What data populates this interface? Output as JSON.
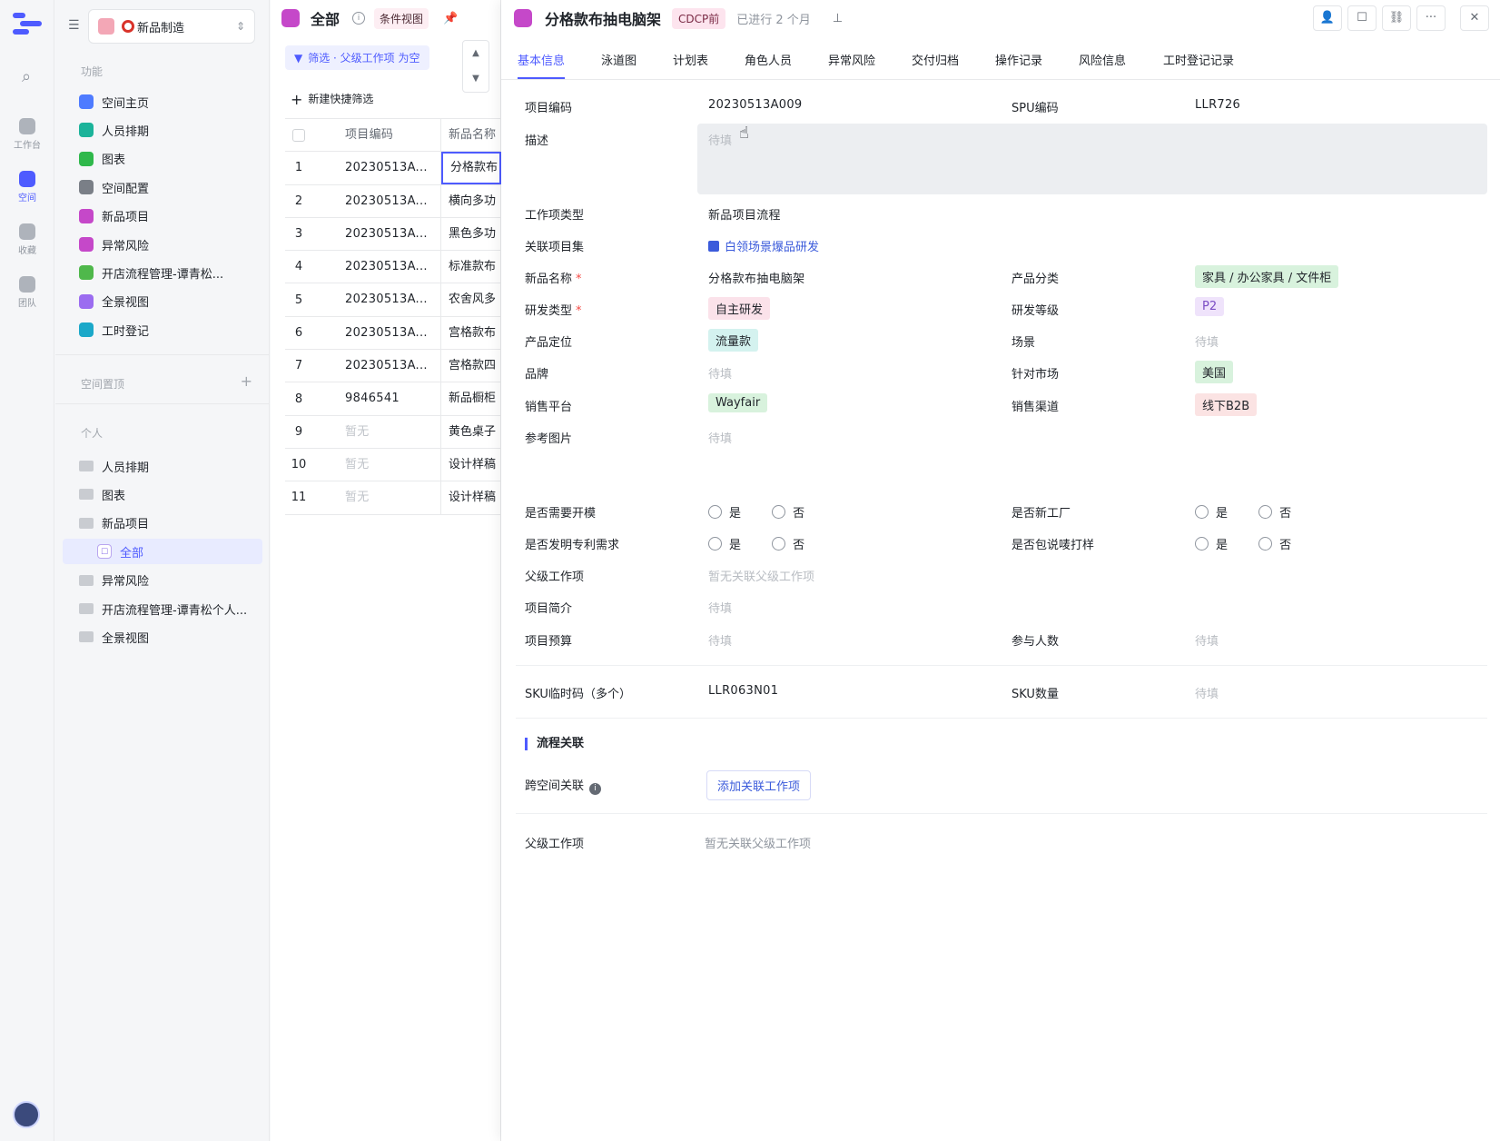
{
  "rail": {
    "items": [
      {
        "label": "工作台"
      },
      {
        "label": "空间"
      },
      {
        "label": "收藏"
      },
      {
        "label": "团队"
      }
    ]
  },
  "sidebar": {
    "space_name": "新品制造",
    "section_features": "功能",
    "features": [
      {
        "label": "空间主页",
        "color": "#4e7bff"
      },
      {
        "label": "人员排期",
        "color": "#1bb39a"
      },
      {
        "label": "图表",
        "color": "#2fb84b"
      },
      {
        "label": "空间配置",
        "color": "#7a7f87"
      },
      {
        "label": "新品项目",
        "color": "#c548c9"
      },
      {
        "label": "异常风险",
        "color": "#c548c9"
      },
      {
        "label": "开店流程管理-谭青松...",
        "color": "#4fb84b"
      },
      {
        "label": "全景视图",
        "color": "#9b6cf0"
      },
      {
        "label": "工时登记",
        "color": "#1ba8c9"
      }
    ],
    "section_pinned": "空间置顶",
    "section_personal": "个人",
    "personal": [
      {
        "label": "人员排期"
      },
      {
        "label": "图表"
      },
      {
        "label": "新品项目"
      },
      {
        "label": "全部",
        "selected": true
      },
      {
        "label": "异常风险"
      },
      {
        "label": "开店流程管理-谭青松个人..."
      },
      {
        "label": "全景视图"
      }
    ]
  },
  "list": {
    "title": "全部",
    "view_badge": "条件视图",
    "filter": "筛选 · 父级工作项 为空",
    "quick_filter": "新建快捷筛选",
    "columns": [
      "项目编码",
      "新品名称"
    ],
    "rows": [
      {
        "idx": "1",
        "code": "20230513A...",
        "name": "分格款布",
        "selected": true
      },
      {
        "idx": "2",
        "code": "20230513A...",
        "name": "横向多功"
      },
      {
        "idx": "3",
        "code": "20230513A...",
        "name": "黑色多功"
      },
      {
        "idx": "4",
        "code": "20230513A...",
        "name": "标准款布"
      },
      {
        "idx": "5",
        "code": "20230513A...",
        "name": "农舍风多"
      },
      {
        "idx": "6",
        "code": "20230513A...",
        "name": "宫格款布"
      },
      {
        "idx": "7",
        "code": "20230513A...",
        "name": "宫格款四"
      },
      {
        "idx": "8",
        "code": "9846541",
        "name": "新品橱柜"
      },
      {
        "idx": "9",
        "code": "暂无",
        "name": "黄色桌子",
        "muted": true
      },
      {
        "idx": "10",
        "code": "暂无",
        "name": "设计样稿",
        "muted": true
      },
      {
        "idx": "11",
        "code": "暂无",
        "name": "设计样稿",
        "muted": true
      }
    ]
  },
  "detail": {
    "title": "分格款布抽电脑架",
    "stage": "CDCP前",
    "progress": "已进行 2 个月",
    "tabs": [
      "基本信息",
      "泳道图",
      "计划表",
      "角色人员",
      "异常风险",
      "交付归档",
      "操作记录",
      "风险信息",
      "工时登记记录"
    ],
    "placeholder": "待填",
    "fields": {
      "project_code_label": "项目编码",
      "project_code": "20230513A009",
      "spu_label": "SPU编码",
      "spu": "LLR726",
      "desc_label": "描述",
      "work_type_label": "工作项类型",
      "work_type": "新品项目流程",
      "linked_set_label": "关联项目集",
      "linked_set": "白领场景爆品研发",
      "name_label": "新品名称",
      "name": "分格款布抽电脑架",
      "category_label": "产品分类",
      "category": "家具 / 办公家具 / 文件柜",
      "rd_type_label": "研发类型",
      "rd_type": "自主研发",
      "rd_level_label": "研发等级",
      "rd_level": "P2",
      "positioning_label": "产品定位",
      "positioning": "流量款",
      "scene_label": "场景",
      "brand_label": "品牌",
      "market_label": "针对市场",
      "market": "美国",
      "platform_label": "销售平台",
      "platform": "Wayfair",
      "channel_label": "销售渠道",
      "channel": "线下B2B",
      "ref_img_label": "参考图片",
      "need_mold_label": "是否需要开模",
      "new_factory_label": "是否新工厂",
      "patent_label": "是否发明专利需求",
      "sample_label": "是否包说唛打样",
      "yes": "是",
      "no": "否",
      "parent_label": "父级工作项",
      "parent": "暂无关联父级工作项",
      "intro_label": "项目简介",
      "budget_label": "项目预算",
      "people_label": "参与人数",
      "sku_tmp_label": "SKU临时码（多个）",
      "sku_tmp": "LLR063N01",
      "sku_count_label": "SKU数量"
    },
    "flow_section": "流程关联",
    "cross_label": "跨空间关联",
    "add_link": "添加关联工作项",
    "bottom_parent_label": "父级工作项",
    "bottom_parent": "暂无关联父级工作项"
  }
}
